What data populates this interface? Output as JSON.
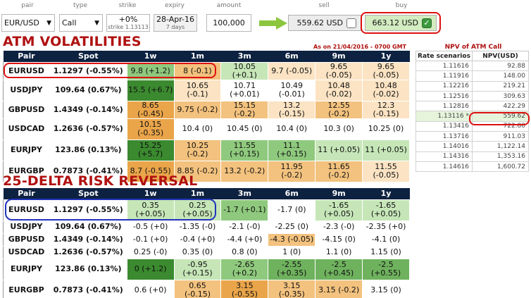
{
  "controls": {
    "labels": {
      "pair": "pair",
      "type": "type",
      "strike": "strike",
      "expiry": "expiry",
      "amount": "amount",
      "sell": "sell",
      "buy": "buy"
    },
    "pair_value": "EUR/USD",
    "type_value": "Call",
    "strike_top": "+0%",
    "strike_sub": "strike 1.13113",
    "expiry_top": "28-Apr-16",
    "expiry_sub": "7 days",
    "amount_value": "100,000",
    "sell_price": "559.62 USD",
    "buy_price": "663.12 USD"
  },
  "atm": {
    "title": "ATM VOLATILITIES",
    "as_of": "As on 21/04/2016 - 0700 GMT",
    "headers": [
      "Pair",
      "Spot",
      "1w",
      "1m",
      "3m",
      "6m",
      "9m",
      "1y"
    ],
    "rows": [
      {
        "pair": "EURUSD",
        "spot": "1.1297 (-0.55%)",
        "cells": [
          "9.8 (+1.2)",
          "8 (-0.1)",
          "10.05 (+0.1)",
          "9.7 (-0.05)",
          "9.65 (-0.05)",
          "9.65 (-0.05)"
        ],
        "colors": [
          "#8fc97d",
          "#f3c27e",
          "#c6e6b8",
          "#fbe3c3",
          "#fbe3c3",
          "#fbe3c3"
        ]
      },
      {
        "pair": "USDJPY",
        "spot": "109.64 (0.67%)",
        "cells": [
          "15.5 (+6.7)",
          "10.65 (-0.1)",
          "10.71 (+0.01)",
          "10.49 (-0.01)",
          "10.48 (-0.02)",
          "10.48 (-0.02)"
        ],
        "colors": [
          "#3b8a2f",
          "#fbe3c3",
          "#ffffff",
          "#ffffff",
          "#fbe3c3",
          "#fbe3c3"
        ]
      },
      {
        "pair": "GBPUSD",
        "spot": "1.4349 (-0.14%)",
        "cells": [
          "8.65 (-0.45)",
          "9.75 (-0.2)",
          "15.15 (-0.2)",
          "13.2 (-0.15)",
          "12.55 (-0.2)",
          "12.3 (-0.15)"
        ],
        "colors": [
          "#eaa54a",
          "#f3c27e",
          "#f3c27e",
          "#fbe3c3",
          "#f3c27e",
          "#fbe3c3"
        ]
      },
      {
        "pair": "USDCAD",
        "spot": "1.2636 (-0.57%)",
        "cells": [
          "10.15 (-0.35)",
          "10.4 (0)",
          "10.45 (0)",
          "10.4 (0)",
          "10.3 (0)",
          "10.25 (0)"
        ],
        "colors": [
          "#eaa54a",
          "#ffffff",
          "#ffffff",
          "#ffffff",
          "#ffffff",
          "#ffffff"
        ]
      },
      {
        "pair": "EURJPY",
        "spot": "123.86 (0.13%)",
        "cells": [
          "15.25 (+5.7)",
          "10.25 (-0.2)",
          "11.55 (+0.15)",
          "11.1 (+0.15)",
          "11 (+0.05)",
          "11 (+0.05)"
        ],
        "colors": [
          "#3b8a2f",
          "#f3c27e",
          "#8fc97d",
          "#8fc97d",
          "#c6e6b8",
          "#c6e6b8"
        ]
      },
      {
        "pair": "EURGBP",
        "spot": "0.7873 (-0.41%)",
        "cells": [
          "8.7 (-0.55)",
          "8.85 (-0.2)",
          "13.2 (-0.2)",
          "11.95 (-0.2)",
          "11.65 (-0.2)",
          "11.55 (-0.05)"
        ],
        "colors": [
          "#eaa54a",
          "#f3c27e",
          "#f3c27e",
          "#f3c27e",
          "#f3c27e",
          "#fbe3c3"
        ]
      }
    ]
  },
  "rr": {
    "title": "25-DELTA RISK REVERSAL",
    "headers": [
      "Pair",
      "Spot",
      "1w",
      "1m",
      "3m",
      "6m",
      "9m",
      "1y"
    ],
    "rows": [
      {
        "pair": "EURUSD",
        "spot": "1.1297 (-0.55%)",
        "cells": [
          "0.35 (+0.05)",
          "0.25 (+0.05)",
          "-1.7 (+0.1)",
          "-1.7 (0)",
          "-1.65 (+0.05)",
          "-1.65 (+0.05)"
        ],
        "colors": [
          "#c6e6b8",
          "#c6e6b8",
          "#8fc97d",
          "#ffffff",
          "#c6e6b8",
          "#c6e6b8"
        ]
      },
      {
        "pair": "USDJPY",
        "spot": "109.64 (0.67%)",
        "cells": [
          "-0.5 (+0)",
          "-1.35 (-0)",
          "-2.1 (-0)",
          "-2.25 (0)",
          "-2.3 (-0)",
          "-2.35 (+0)"
        ],
        "colors": [
          "#ffffff",
          "#ffffff",
          "#ffffff",
          "#ffffff",
          "#ffffff",
          "#ffffff"
        ]
      },
      {
        "pair": "GBPUSD",
        "spot": "1.4349 (-0.14%)",
        "cells": [
          "-0.1 (+0)",
          "-0.4 (+0)",
          "-4.4 (+0)",
          "-4.3 (-0.05)",
          "-4.15 (0)",
          "-4.1 (0)"
        ],
        "colors": [
          "#ffffff",
          "#ffffff",
          "#ffffff",
          "#f3c27e",
          "#ffffff",
          "#ffffff"
        ]
      },
      {
        "pair": "USDCAD",
        "spot": "1.2636 (-0.57%)",
        "cells": [
          "0.25 (-0)",
          "0.35 (0)",
          "0.8 (0)",
          "1 (0)",
          "1.1 (0)",
          "1.15 (0)"
        ],
        "colors": [
          "#ffffff",
          "#ffffff",
          "#ffffff",
          "#ffffff",
          "#ffffff",
          "#ffffff"
        ]
      },
      {
        "pair": "EURJPY",
        "spot": "123.86 (0.13%)",
        "cells": [
          "0 (+1.2)",
          "-0.95 (+0.15)",
          "-2.65 (+0.2)",
          "-2.55 (+0.35)",
          "-2.5 (+0.45)",
          "-2.5 (+0.55)"
        ],
        "colors": [
          "#3b8a2f",
          "#c6e6b8",
          "#8fc97d",
          "#6fb25e",
          "#6fb25e",
          "#6fb25e"
        ]
      },
      {
        "pair": "EURGBP",
        "spot": "0.7873 (-0.41%)",
        "cells": [
          "0.6 (+0)",
          "0.65 (-0.15)",
          "3.15 (-0.55)",
          "3.15 (-0.35)",
          "3.15 (-0.2)",
          "3.15 (0)"
        ],
        "colors": [
          "#ffffff",
          "#f3c27e",
          "#eaa54a",
          "#f3c27e",
          "#f3c27e",
          "#ffffff"
        ]
      }
    ]
  },
  "npv": {
    "title": "NPV of ATM Call",
    "headers": [
      "Rate scenarios",
      "NPV(USD)"
    ],
    "rows": [
      [
        "1.11616",
        "92.88"
      ],
      [
        "1.11916",
        "148.00"
      ],
      [
        "1.12216",
        "219.21"
      ],
      [
        "1.12516",
        "309.63"
      ],
      [
        "1.12816",
        "422.29"
      ],
      [
        "1.13116 *",
        "559.62"
      ],
      [
        "1.13416",
        "722.80"
      ],
      [
        "1.13716",
        "911.03"
      ],
      [
        "1.14016",
        "1,122.14"
      ],
      [
        "1.14316",
        "1,353.16"
      ],
      [
        "1.14616",
        "1,600.72"
      ]
    ],
    "highlight_index": 5
  }
}
